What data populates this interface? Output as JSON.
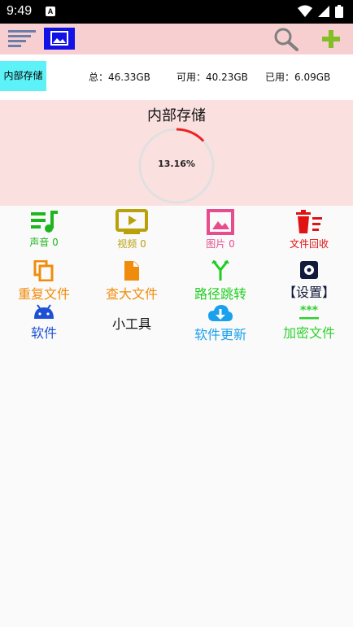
{
  "status_bar": {
    "time": "9:49",
    "notification_letter": "A"
  },
  "toolbar": {
    "icons": [
      "menu-icon",
      "image-icon",
      "search-icon",
      "add-icon"
    ]
  },
  "storage": {
    "tab_label": "内部存储",
    "total": "总：46.33GB",
    "available": "可用：40.23GB",
    "used": "已用：6.09GB"
  },
  "panel": {
    "title": "内部存储",
    "percent_label": "13.16%",
    "percent_value": 13.16
  },
  "categories": [
    {
      "label": "声音 0",
      "color": "#1fb51f",
      "icon": "music-list-icon"
    },
    {
      "label": "视频 0",
      "color": "#b9a10c",
      "icon": "video-icon"
    },
    {
      "label": "图片 0",
      "color": "#e64d8f",
      "icon": "image-icon"
    },
    {
      "label": "文件回收",
      "color": "#e01313",
      "icon": "trash-icon"
    }
  ],
  "tools_row1": [
    {
      "label": "重复文件",
      "color": "#f08c0c",
      "icon": "copy-icon"
    },
    {
      "label": "查大文件",
      "color": "#f08c0c",
      "icon": "file-icon"
    },
    {
      "label": "路径跳转",
      "color": "#1fce1f",
      "icon": "merge-icon"
    },
    {
      "label": "【设置】",
      "color": "#111a3a",
      "icon": "gear-icon"
    }
  ],
  "tools_row2": [
    {
      "label": "软件",
      "color": "#1e50d6",
      "icon": "android-icon"
    },
    {
      "label": "小工具",
      "color": "#111111",
      "icon": ""
    },
    {
      "label": "软件更新",
      "color": "#1ba0ee",
      "icon": "cloud-download-icon"
    },
    {
      "label": "加密文件",
      "color": "#2dd12d",
      "icon": "password-icon"
    }
  ]
}
